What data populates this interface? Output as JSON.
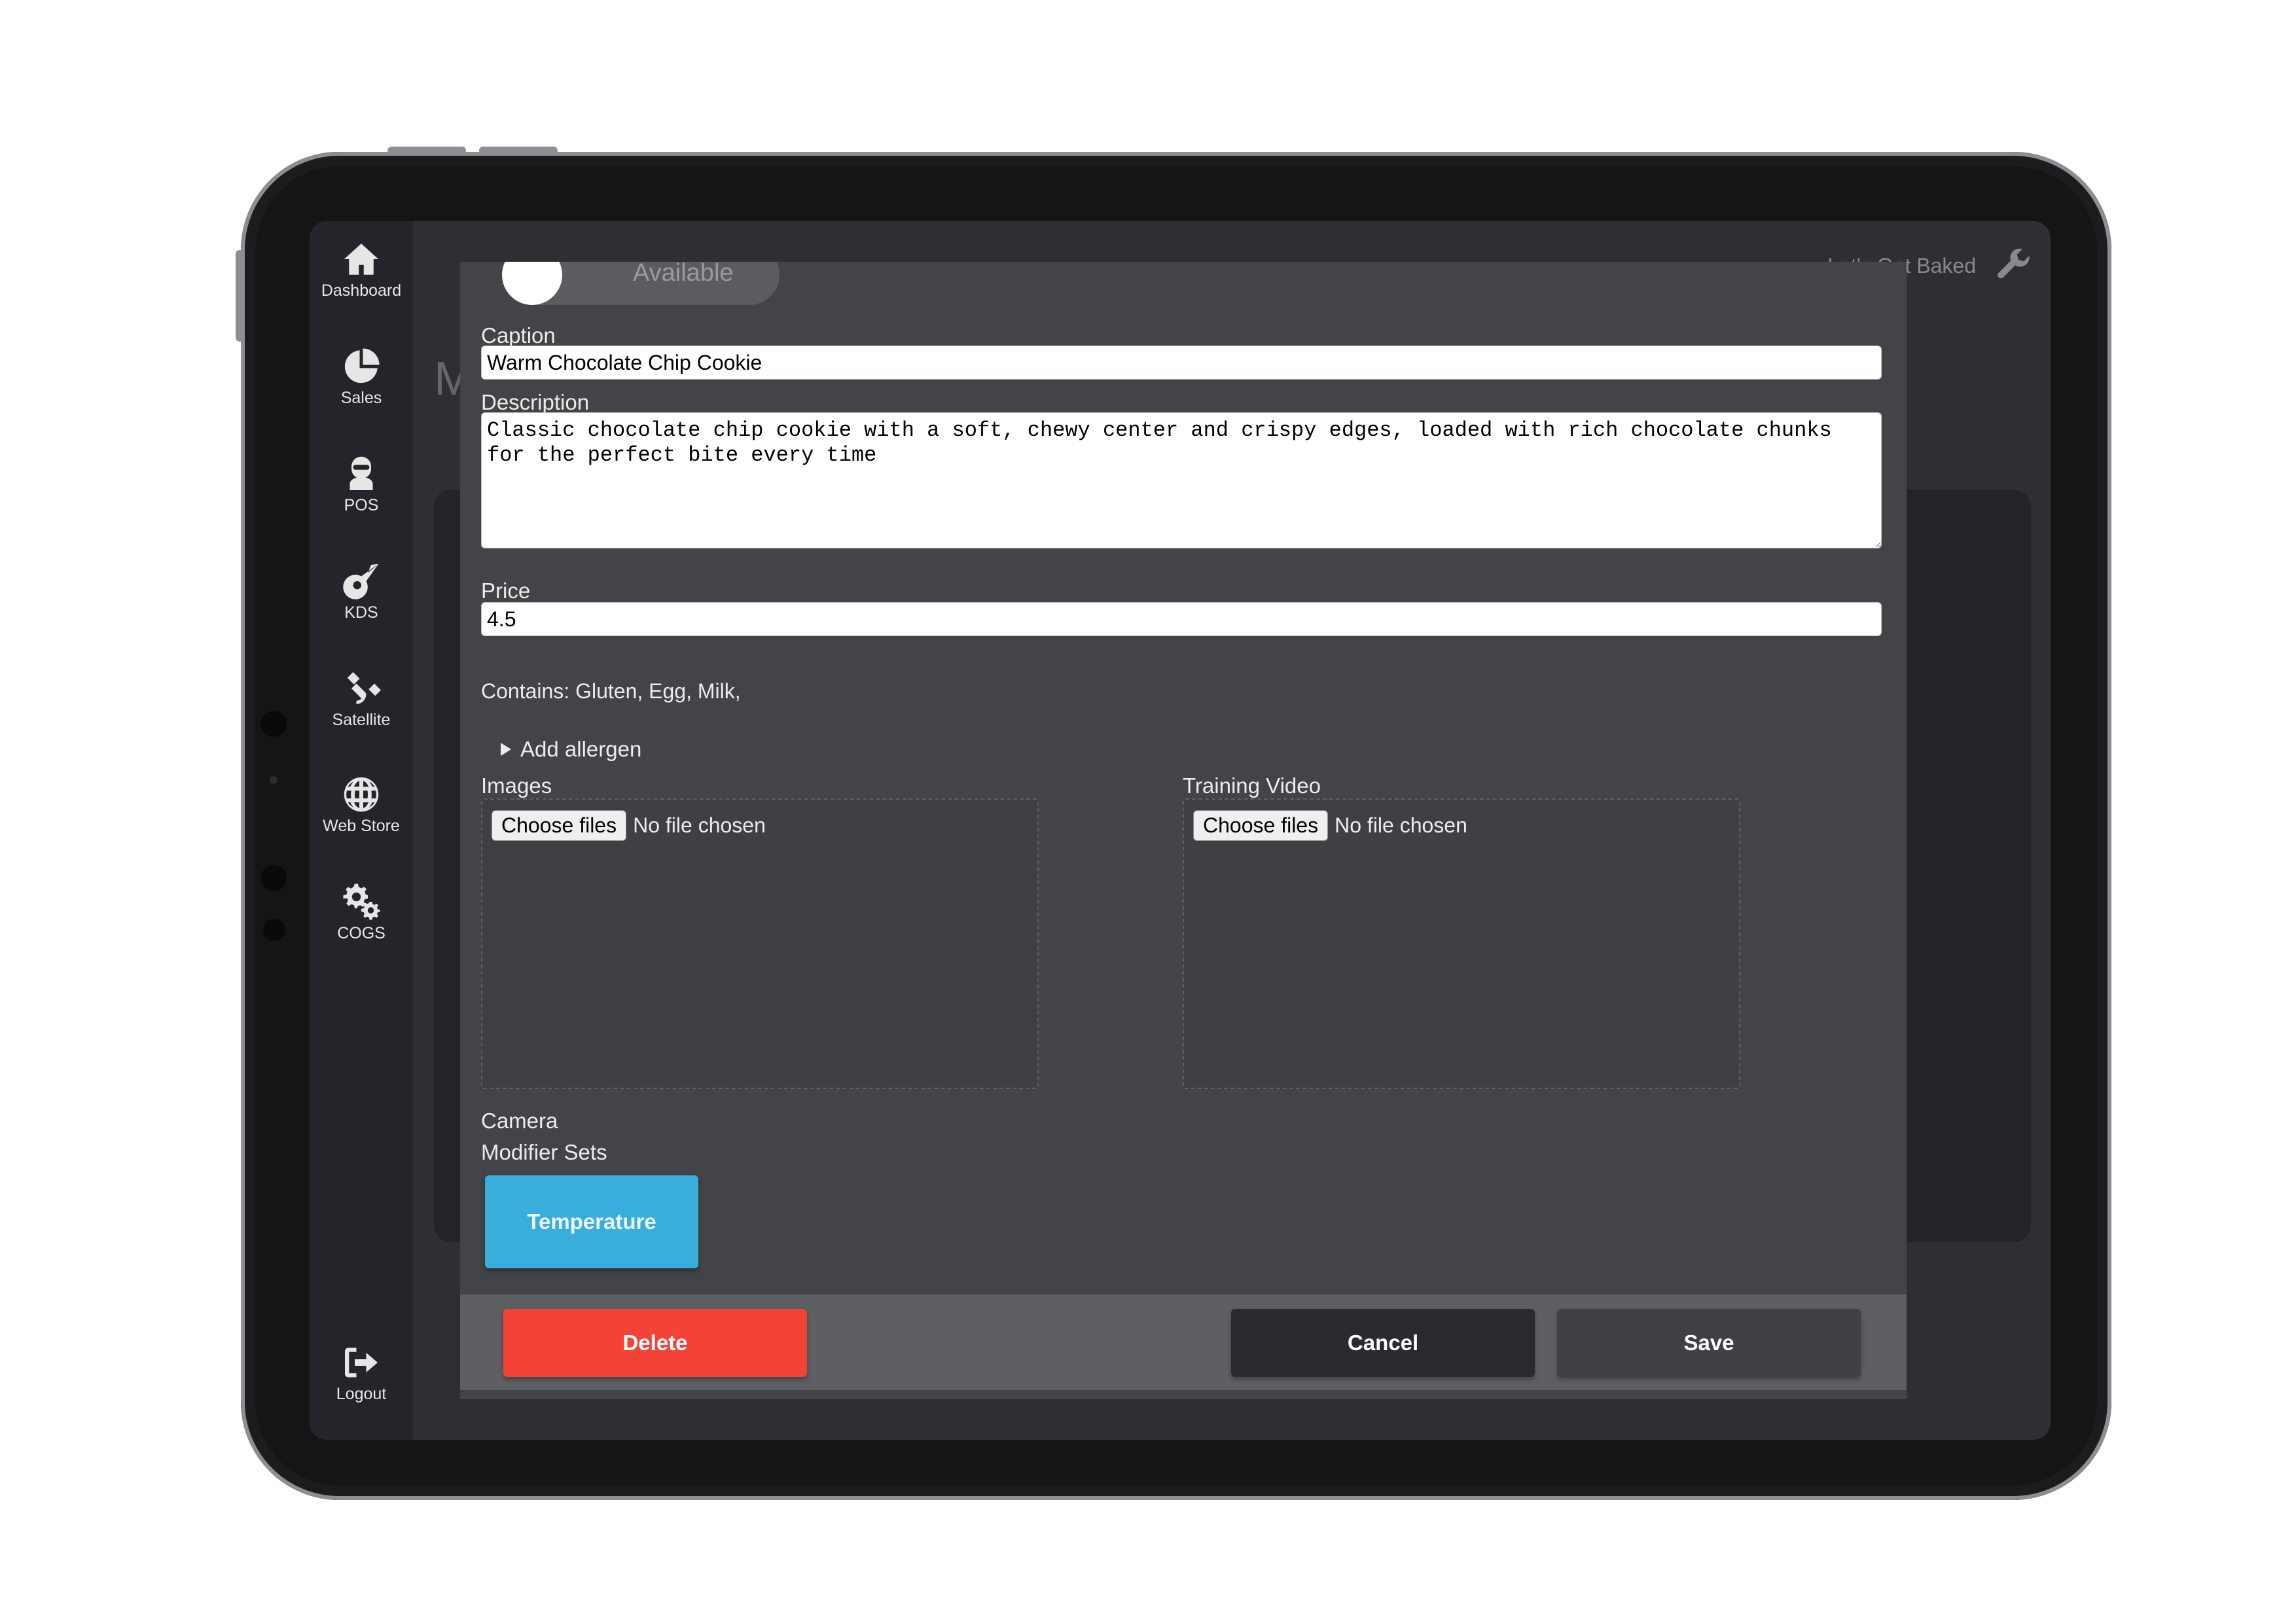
{
  "sidebar": {
    "items": [
      {
        "label": "Dashboard",
        "icon": "home-icon"
      },
      {
        "label": "Sales",
        "icon": "pie-chart-icon"
      },
      {
        "label": "POS",
        "icon": "astronaut-icon"
      },
      {
        "label": "KDS",
        "icon": "comet-icon"
      },
      {
        "label": "Satellite",
        "icon": "satellite-icon"
      },
      {
        "label": "Web Store",
        "icon": "globe-icon"
      },
      {
        "label": "COGS",
        "icon": "gears-icon"
      }
    ],
    "logout": {
      "label": "Logout",
      "icon": "logout-icon"
    }
  },
  "topbar": {
    "store_name": "Let's Get Baked",
    "settings_icon": "wrench-icon"
  },
  "background": {
    "header_initial": "M"
  },
  "modal": {
    "availability": {
      "label": "Available",
      "state": "on"
    },
    "caption": {
      "label": "Caption",
      "value": "Warm Chocolate Chip Cookie"
    },
    "description": {
      "label": "Description",
      "value": "Classic chocolate chip cookie with a soft, chewy center and crispy edges, loaded with rich chocolate chunks for the perfect bite every time"
    },
    "price": {
      "label": "Price",
      "value": "4.5"
    },
    "contains_text": "Contains: Gluten, Egg, Milk,",
    "add_allergen": "Add allergen",
    "images": {
      "label": "Images",
      "button": "Choose files",
      "status": "No file chosen"
    },
    "training_video": {
      "label": "Training Video",
      "button": "Choose files",
      "status": "No file chosen"
    },
    "camera_label": "Camera",
    "modifier_sets": {
      "label": "Modifier Sets",
      "items": [
        "Temperature"
      ]
    },
    "footer": {
      "delete_label": "Delete",
      "cancel_label": "Cancel",
      "save_label": "Save"
    }
  },
  "colors": {
    "delete": "#f54236",
    "modifier": "#3aaedb",
    "modal_bg": "#434448",
    "sidebar_bg": "#24252a"
  }
}
